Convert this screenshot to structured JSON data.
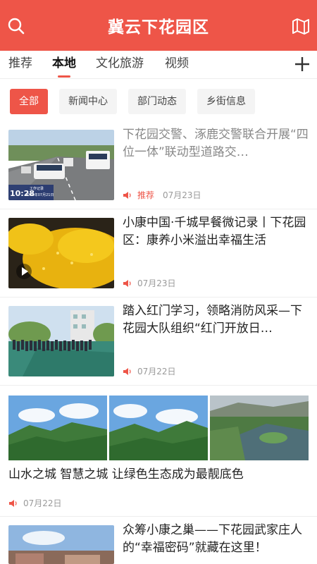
{
  "header": {
    "title": "冀云下花园区",
    "left_icon": "search-icon",
    "right_icon": "map-icon",
    "bg_color": "#ee5548"
  },
  "tabs": [
    {
      "label": "推荐",
      "active": false
    },
    {
      "label": "本地",
      "active": true
    },
    {
      "label": "文化旅游",
      "active": false
    },
    {
      "label": "视频",
      "active": false
    }
  ],
  "chips": [
    {
      "label": "全部",
      "active": true
    },
    {
      "label": "新闻中心",
      "active": false
    },
    {
      "label": "部门动态",
      "active": false
    },
    {
      "label": "乡街信息",
      "active": false
    }
  ],
  "news": [
    {
      "title": "下花园交警、涿鹿交警联合开展“四位一体”联动型道路交…",
      "tag": "推荐",
      "date": "07月23日",
      "thumb_overlay_time": "10:28",
      "thumb_overlay_date": "2020年07月21日",
      "thumb_overlay_label": "工作记录"
    },
    {
      "title": "小康中国·千城早餐微记录丨下花园区：康养小米溢出幸福生活",
      "date": "07月23日"
    },
    {
      "title": "踏入红门学习，领略消防风采—下花园大队组织“红门开放日…",
      "date": "07月22日"
    },
    {
      "title": "山水之城 智慧之城 让绿色生态成为最靓底色",
      "date": "07月22日"
    },
    {
      "title": "众筹小康之巢——下花园武家庄人的“幸福密码”就藏在这里！"
    }
  ]
}
